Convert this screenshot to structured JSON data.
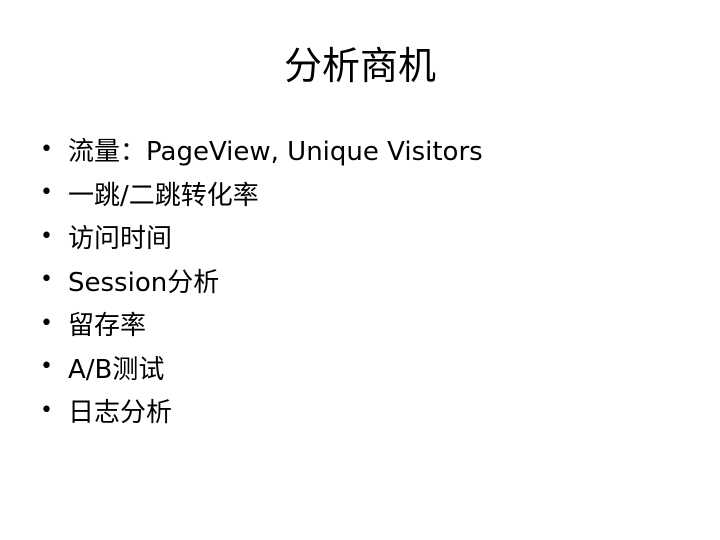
{
  "slide": {
    "title": "分析商机",
    "bullet_symbol": "•",
    "bullets": [
      "流量：PageView, Unique Visitors",
      "一跳/二跳转化率",
      "访问时间",
      "Session分析",
      "留存率",
      "A/B测试",
      "日志分析"
    ]
  }
}
